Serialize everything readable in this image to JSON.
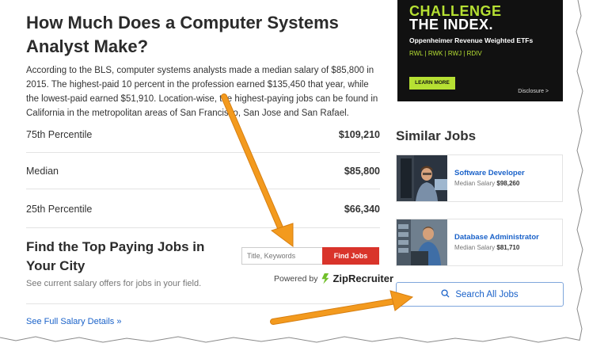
{
  "article": {
    "title": "How Much Does a Computer Systems Analyst Make?",
    "intro": "According to the BLS, computer systems analysts made a median salary of $85,800 in 2015. The highest-paid 10 percent in the profession earned $135,450 that year, while the lowest-paid earned $51,910. Location-wise, the highest-paying jobs can be found in California in the metropolitan areas of San Francisco, San Jose and San Rafael."
  },
  "percentiles": [
    {
      "label": "75th Percentile",
      "value": "$109,210"
    },
    {
      "label": "Median",
      "value": "$85,800"
    },
    {
      "label": "25th Percentile",
      "value": "$66,340"
    }
  ],
  "find_jobs": {
    "title": "Find the Top Paying Jobs in Your City",
    "subtitle": "See current salary offers for jobs in your field.",
    "placeholder": "Title, Keywords",
    "button": "Find Jobs",
    "powered_by": "Powered by",
    "brand": "ZipRecruiter"
  },
  "details_link": "See Full Salary Details »",
  "ad": {
    "line1": "CHALLENGE",
    "line2": "THE INDEX.",
    "subtitle": "Oppenheimer Revenue Weighted ETFs",
    "tickers": "RWL  |  RWK  |  RWJ  |  RDIV",
    "button": "LEARN MORE",
    "disclosure": "Disclosure >",
    "accent_color": "#b6e033"
  },
  "similar_jobs": {
    "title": "Similar Jobs",
    "items": [
      {
        "name": "Software Developer",
        "salary_label": "Median Salary",
        "salary": "$98,260"
      },
      {
        "name": "Database Administrator",
        "salary_label": "Median Salary",
        "salary": "$81,710"
      }
    ],
    "search_all": "Search All Jobs"
  },
  "colors": {
    "link": "#1a62c9",
    "find_button": "#d9342b",
    "annotation_arrow": "#f39a1e"
  }
}
